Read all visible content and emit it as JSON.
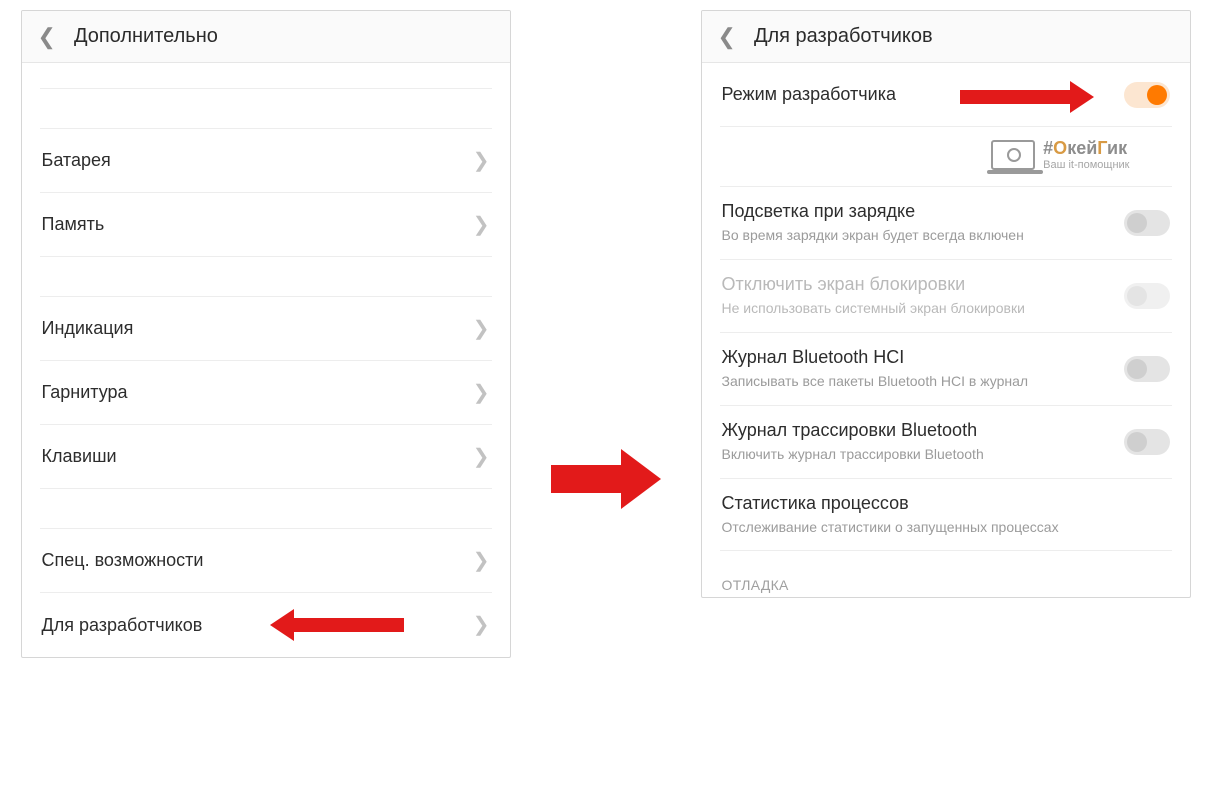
{
  "left": {
    "title": "Дополнительно",
    "items": [
      {
        "label": "Батарея"
      },
      {
        "label": "Память"
      },
      {
        "label": "Индикация"
      },
      {
        "label": "Гарнитура"
      },
      {
        "label": "Клавиши"
      },
      {
        "label": "Спец. возможности"
      },
      {
        "label": "Для разработчиков"
      }
    ]
  },
  "right": {
    "title": "Для разработчиков",
    "items": [
      {
        "label": "Режим разработчика",
        "toggle": true,
        "on": true
      },
      {
        "label": "Подсветка при зарядке",
        "sub": "Во время зарядки экран будет всегда включен",
        "toggle": true,
        "on": false
      },
      {
        "label": "Отключить экран блокировки",
        "sub": "Не использовать системный экран блокировки",
        "toggle": true,
        "on": false,
        "disabled": true
      },
      {
        "label": "Журнал Bluetooth HCI",
        "sub": "Записывать все пакеты Bluetooth HCI в журнал",
        "toggle": true,
        "on": false
      },
      {
        "label": "Журнал трассировки Bluetooth",
        "sub": "Включить журнал трассировки Bluetooth",
        "toggle": true,
        "on": false
      },
      {
        "label": "Статистика процессов",
        "sub": "Отслеживание статистики о запущенных процессах"
      }
    ],
    "section": "ОТЛАДКА"
  },
  "watermark": {
    "line1_hash": "#",
    "line1_a": "О",
    "line1_b": "кей",
    "line1_c": "Г",
    "line1_d": "ик",
    "line2": "Ваш it-помощник"
  }
}
